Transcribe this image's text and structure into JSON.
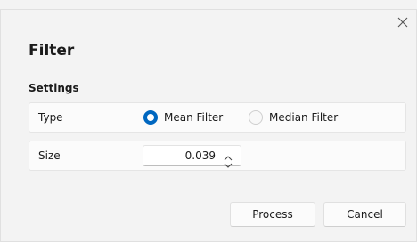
{
  "dialog": {
    "title": "Filter",
    "close_icon": "close-icon",
    "section_label": "Settings"
  },
  "settings": {
    "type": {
      "label": "Type",
      "options": [
        {
          "label": "Mean Filter",
          "selected": true
        },
        {
          "label": "Median Filter",
          "selected": false
        }
      ]
    },
    "size": {
      "label": "Size",
      "value": "0.039"
    }
  },
  "buttons": {
    "process": "Process",
    "cancel": "Cancel"
  },
  "colors": {
    "accent": "#0067c0",
    "background": "#f3f3f3",
    "row_background": "#fbfbfb"
  }
}
